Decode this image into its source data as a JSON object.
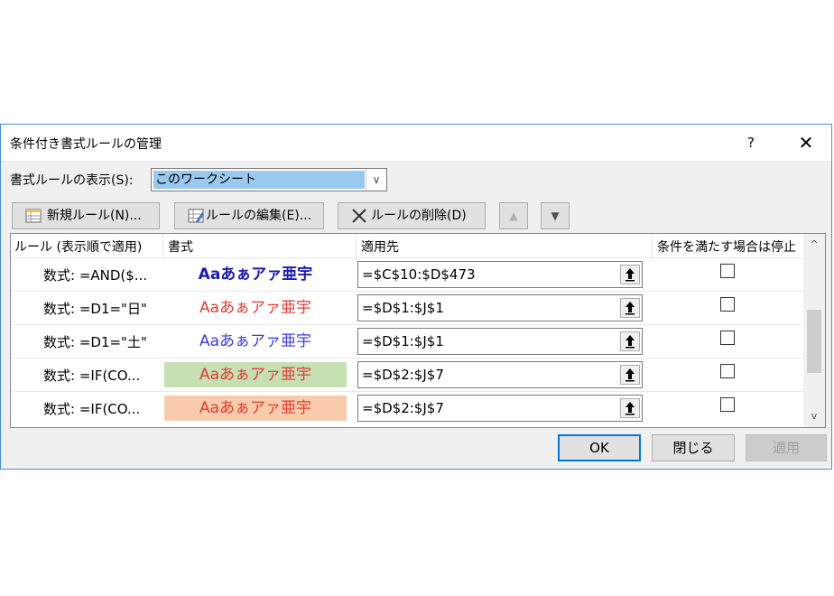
{
  "dialog": {
    "title": "条件付き書式ルールの管理",
    "help": "?",
    "close": "✕"
  },
  "show": {
    "label": "書式ルールの表示(S):",
    "value": "このワークシート",
    "arrow": "∨"
  },
  "toolbar": {
    "new_rule": "新規ルール(N)...",
    "edit_rule": "ルールの編集(E)...",
    "delete_rule": "ルールの削除(D)",
    "move_up": "▲",
    "move_down": "▼"
  },
  "columns": {
    "rule": "ルール (表示順で適用)",
    "format": "書式",
    "applies_to": "適用先",
    "stop_if_true": "条件を満たす場合は停止"
  },
  "format_preview": "Aaあぁアァ亜宇",
  "rows": [
    {
      "rule": "数式: =AND($...",
      "applies_to": "=$C$10:$D$473",
      "fmt_color": "#1a1ab0",
      "fmt_bg": "transparent",
      "bold": true,
      "stop_if_true": false
    },
    {
      "rule": "数式: =D1=\"日\"",
      "applies_to": "=$D$1:$J$1",
      "fmt_color": "#e03c31",
      "fmt_bg": "transparent",
      "bold": false,
      "stop_if_true": false
    },
    {
      "rule": "数式: =D1=\"土\"",
      "applies_to": "=$D$1:$J$1",
      "fmt_color": "#3a3ae0",
      "fmt_bg": "transparent",
      "bold": false,
      "stop_if_true": false
    },
    {
      "rule": "数式: =IF(CO...",
      "applies_to": "=$D$2:$J$7",
      "fmt_color": "#e03c31",
      "fmt_bg": "#c6e0b4",
      "bold": false,
      "stop_if_true": false
    },
    {
      "rule": "数式: =IF(CO...",
      "applies_to": "=$D$2:$J$7",
      "fmt_color": "#e03c31",
      "fmt_bg": "#f8cbad",
      "bold": false,
      "stop_if_true": false
    }
  ],
  "footer": {
    "ok": "OK",
    "close": "閉じる",
    "apply": "適用"
  },
  "colors": {
    "selection": "#99c9ef",
    "dialog_bg": "#f0f0f0",
    "ok_border": "#0078d7"
  }
}
